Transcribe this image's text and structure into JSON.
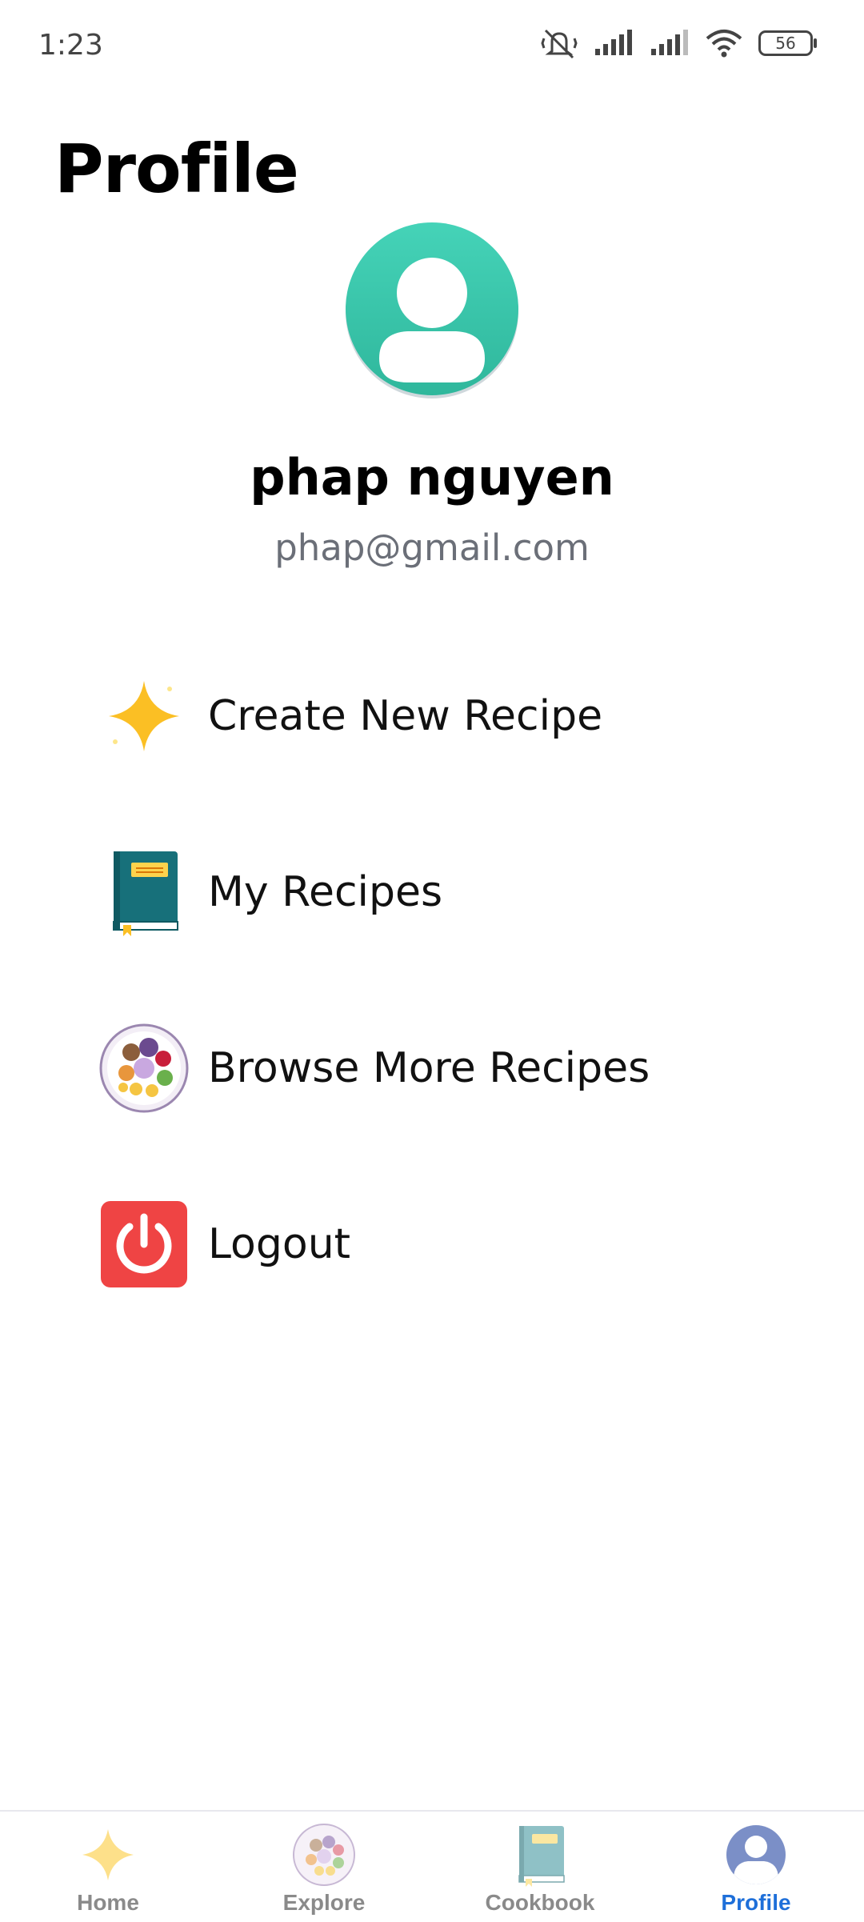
{
  "status_bar": {
    "time": "1:23",
    "battery": "56",
    "icons": [
      "mute-icon",
      "signal-icon",
      "signal-icon",
      "wifi-icon",
      "battery-icon"
    ]
  },
  "page": {
    "title": "Profile"
  },
  "user": {
    "name": "phap nguyen",
    "email": "phap@gmail.com"
  },
  "menu": [
    {
      "label": "Create New Recipe",
      "icon": "sparkle-icon"
    },
    {
      "label": "My Recipes",
      "icon": "book-icon"
    },
    {
      "label": "Browse More Recipes",
      "icon": "food-plate-icon"
    },
    {
      "label": "Logout",
      "icon": "power-icon"
    }
  ],
  "bottom_nav": [
    {
      "label": "Home",
      "icon": "sparkle-icon",
      "active": false
    },
    {
      "label": "Explore",
      "icon": "food-plate-icon",
      "active": false
    },
    {
      "label": "Cookbook",
      "icon": "book-icon",
      "active": false
    },
    {
      "label": "Profile",
      "icon": "avatar-icon",
      "active": true
    }
  ],
  "colors": {
    "accent": "#1e6fd9",
    "avatar": "#3cc7ad",
    "logout": "#ef4444",
    "book": "#17707a",
    "sparkle": "#fbbf24"
  }
}
